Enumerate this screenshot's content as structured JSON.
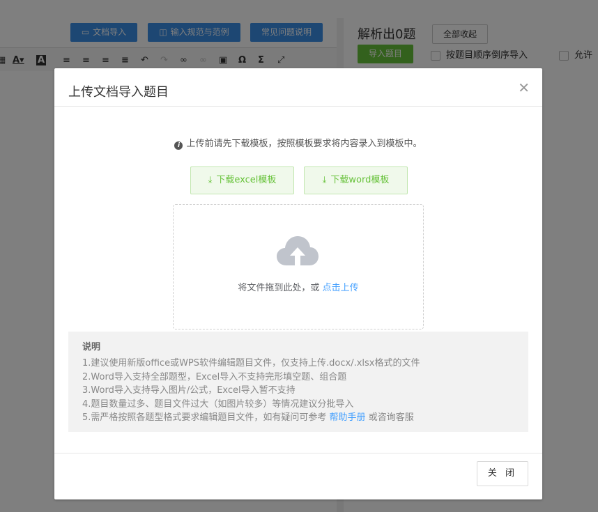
{
  "background": {
    "toolbar_buttons": [
      {
        "icon": "folder-icon",
        "label": "文档导入"
      },
      {
        "icon": "book-icon",
        "label": "输入规范与范例"
      },
      {
        "label": "常见问题说明"
      }
    ],
    "editor_tools": [
      "font-color-icon",
      "highlight-icon",
      "align-left-icon",
      "align-center-icon",
      "align-right-icon",
      "align-justify-icon",
      "undo-icon",
      "redo-icon",
      "link-icon",
      "unlink-icon",
      "image-icon",
      "omega-icon",
      "sigma-icon",
      "fullscreen-icon"
    ],
    "parse_title": "解析出0题",
    "collapse_all": "全部收起",
    "import_questions": "导入题目",
    "checkbox_reverse_order": "按题目顺序倒序导入",
    "checkbox_allow": "允许"
  },
  "modal": {
    "title": "上传文档导入题目",
    "hint": "上传前请先下载模板，按照模板要求将内容录入到模板中。",
    "download_excel": "下载excel模板",
    "download_word": "下载word模板",
    "drop_text": "将文件拖到此处，或 ",
    "drop_link": "点击上传",
    "notes_title": "说明",
    "notes": [
      "1.建议使用新版office或WPS软件编辑题目文件，仅支持上传.docx/.xlsx格式的文件",
      "2.Word导入支持全部题型，Excel导入不支持完形填空题、组合题",
      "3.Word导入支持导入图片/公式，Excel导入暂不支持",
      "4.题目数量过多、题目文件过大（如图片较多）等情况建议分批导入"
    ],
    "note5_prefix": "5.需严格按照各题型格式要求编辑题目文件，如有疑问可参考 ",
    "note5_link": "帮助手册",
    "note5_suffix": " 或咨询客服",
    "close_label": "关 闭"
  },
  "colors": {
    "primary_blue": "#3a8ee6",
    "success_green": "#67c23a",
    "link_blue": "#409eff"
  }
}
